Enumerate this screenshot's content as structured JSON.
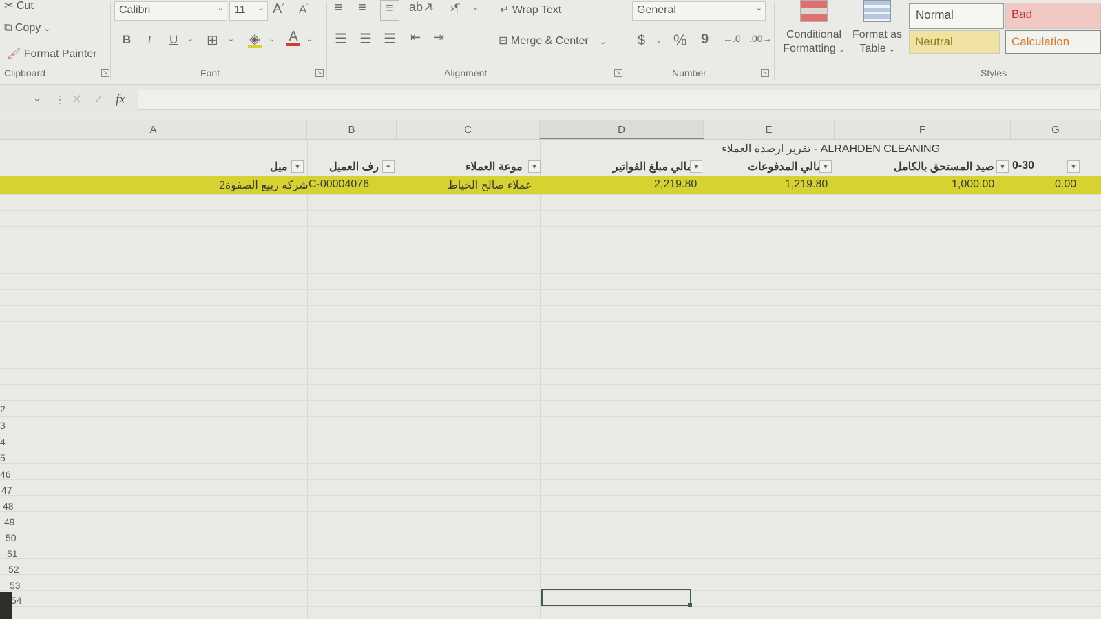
{
  "ribbon": {
    "clipboard": {
      "cut": "Cut",
      "copy": "Copy",
      "format_painter": "Format Painter",
      "label": "Clipboard"
    },
    "font": {
      "name": "Calibri",
      "size": "11",
      "bold": "B",
      "italic": "I",
      "underline": "U",
      "label": "Font"
    },
    "alignment": {
      "wrap_text": "Wrap Text",
      "merge_center": "Merge & Center",
      "label": "Alignment"
    },
    "number": {
      "format": "General",
      "currency": "$",
      "percent": "%",
      "comma": "9",
      "label": "Number"
    },
    "styles": {
      "conditional_formatting": [
        "Conditional",
        "Formatting"
      ],
      "format_as_table": [
        "Format as",
        "Table"
      ],
      "normal": "Normal",
      "bad": "Bad",
      "neutral": "Neutral",
      "calculation": "Calculation",
      "label": "Styles"
    }
  },
  "formula_bar": {
    "fx": "fx",
    "value": ""
  },
  "columns": [
    "A",
    "B",
    "C",
    "D",
    "E",
    "F",
    "G"
  ],
  "sheet": {
    "title": "تقرير ارصدة العملاء - ALRAHDEN CLEANING",
    "headers": {
      "a": "ميل",
      "b": "رف العميل",
      "c": "موعة العملاء",
      "d": "مالي مبلغ الفواتير",
      "e": "مالي المدفوعات",
      "f": "صيد المستحق بالكامل",
      "g": "0-30"
    },
    "row": {
      "a": "شركه ربيع الصفوة2",
      "b": "C-00004076",
      "c": "عملاء صالح الخياط",
      "d": "2,219.80",
      "e": "1,219.80",
      "f": "1,000.00",
      "g": "0.00"
    }
  },
  "row_numbers": [
    "2",
    "3",
    "4",
    "5",
    "46",
    "47",
    "48",
    "49",
    "50",
    "51",
    "52",
    "53",
    "54"
  ],
  "colors": {
    "highlight_row": "#d6d232",
    "bad_style": "#f2c8c4",
    "neutral_style": "#f0e2a0",
    "calculation_text": "#d07a30"
  }
}
